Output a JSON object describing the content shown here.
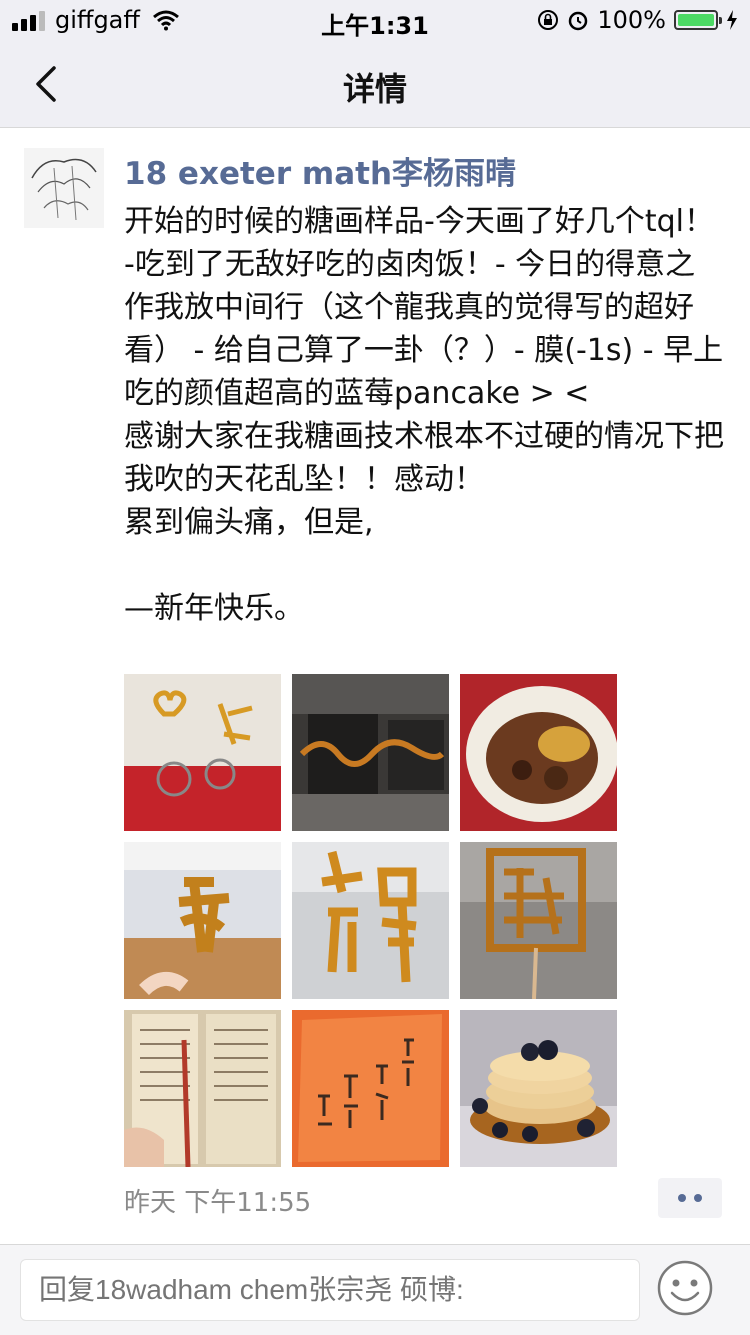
{
  "status_bar": {
    "carrier": "giffgaff",
    "time": "上午1:31",
    "battery": "100%"
  },
  "nav": {
    "title": "详情"
  },
  "post": {
    "author": "18 exeter math李杨雨晴",
    "text": "开始的时候的糖画样品-今天画了好几个tql！-吃到了无敌好吃的卤肉饭！- 今日的得意之作我放中间行（这个龍我真的觉得写的超好看） - 给自己算了一卦（？）- 膜(-1s) - 早上吃的颜值超高的蓝莓pancake > <\n感谢大家在我糖画技术根本不过硬的情况下把我吹的天花乱坠！！感动！\n累到偏头痛，但是,\n\n—新年快乐。",
    "timestamp": "昨天 下午11:55"
  },
  "comment": {
    "placeholder": "回复18wadham chem张宗尧 硕博:"
  },
  "colors": {
    "link_blue": "#576b95",
    "nav_bg": "#efeff4",
    "battery_green": "#4cd964"
  },
  "icons": [
    "back-chevron-icon",
    "wifi-icon",
    "lock-rotation-icon",
    "alarm-icon",
    "battery-icon",
    "charging-icon",
    "more-dots-icon",
    "emoji-icon"
  ]
}
